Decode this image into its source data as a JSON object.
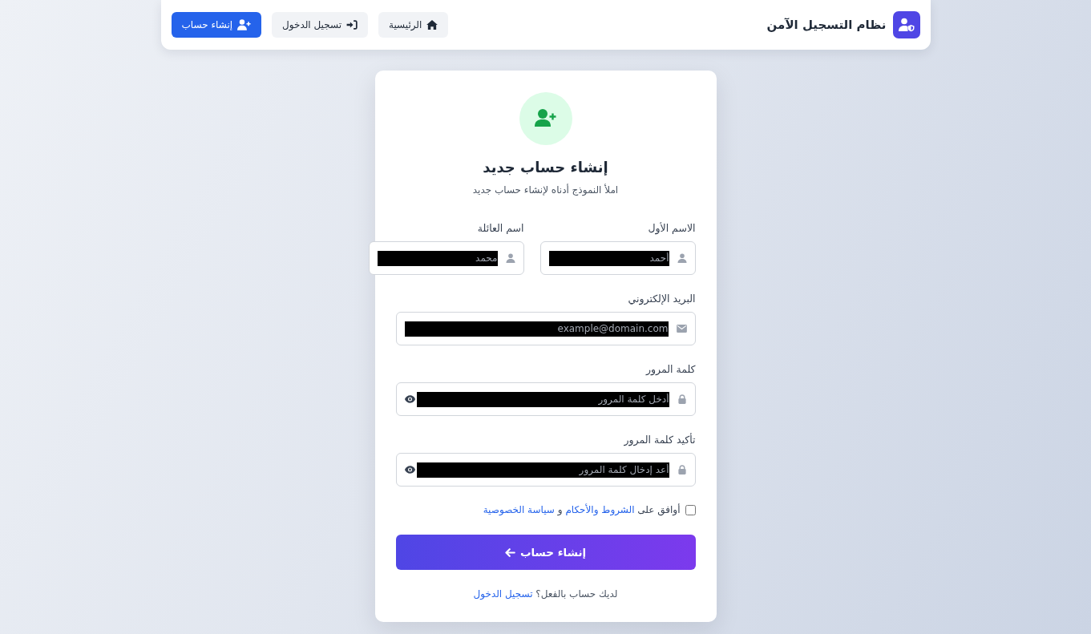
{
  "header": {
    "title": "نظام التسجيل الآمن",
    "nav": [
      {
        "label": "الرئيسية",
        "kind": "home",
        "selected": false
      },
      {
        "label": "تسجيل الدخول",
        "kind": "login",
        "selected": false
      },
      {
        "label": "إنشاء حساب",
        "kind": "register",
        "selected": true
      }
    ]
  },
  "card": {
    "title": "إنشاء حساب جديد",
    "subtitle": "املأ النموذج أدناه لإنشاء حساب جديد"
  },
  "name_fields": [
    {
      "label": "الاسم الأول",
      "placeholder": "أحمد",
      "kind": "name"
    },
    {
      "label": "اسم العائلة",
      "placeholder": "محمد",
      "kind": "name"
    }
  ],
  "fields": [
    {
      "label": "البريد الإلكتروني",
      "placeholder": "example@domain.com",
      "kind": "email"
    },
    {
      "label": "كلمة المرور",
      "placeholder": "أدخل كلمة المرور",
      "kind": "password"
    },
    {
      "label": "تأكيد كلمة المرور",
      "placeholder": "أعد إدخال كلمة المرور",
      "kind": "password"
    }
  ],
  "terms": {
    "checked": false,
    "parts": [
      {
        "kind": "text",
        "text": "أوافق على"
      },
      {
        "kind": "link",
        "text": "الشروط والأحكام"
      },
      {
        "kind": "text",
        "text": "و"
      },
      {
        "kind": "link",
        "text": "سياسة الخصوصية"
      }
    ]
  },
  "submit": {
    "label": "إنشاء حساب"
  },
  "footer": {
    "text": "لديك حساب بالفعل؟",
    "link": "تسجيل الدخول"
  }
}
